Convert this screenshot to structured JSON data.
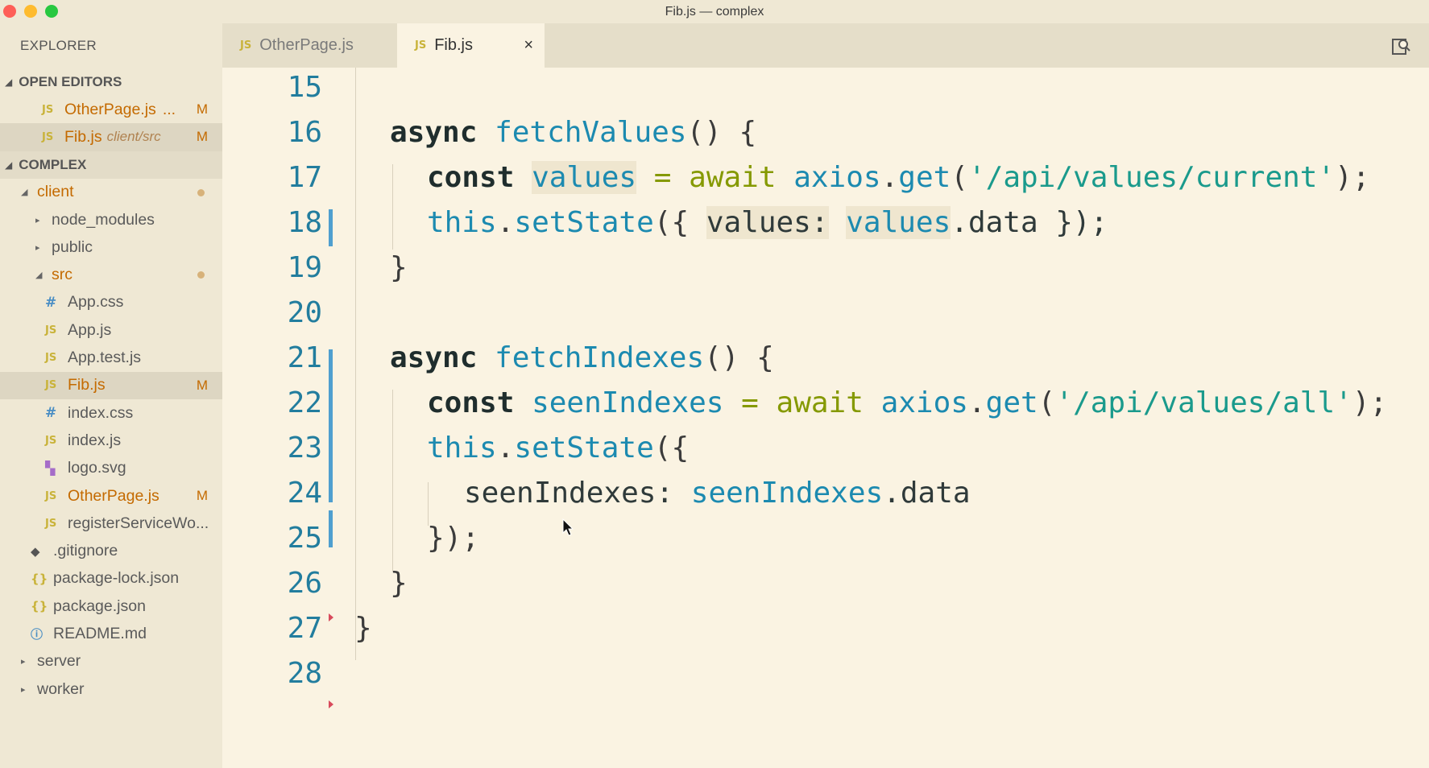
{
  "window": {
    "title": "Fib.js — complex"
  },
  "sidebar": {
    "header": "EXPLORER",
    "open_editors_label": "OPEN EDITORS",
    "open_editors": [
      {
        "name": "OtherPage.js",
        "extra": "...",
        "badge": "M"
      },
      {
        "name": "Fib.js",
        "extra": "client/src",
        "badge": "M"
      }
    ],
    "project_label": "COMPLEX",
    "tree": {
      "client": "client",
      "node_modules": "node_modules",
      "public": "public",
      "src": "src",
      "app_css": "App.css",
      "app_js": "App.js",
      "app_test_js": "App.test.js",
      "fib_js": "Fib.js",
      "fib_badge": "M",
      "index_css": "index.css",
      "index_js": "index.js",
      "logo_svg": "logo.svg",
      "otherpage_js": "OtherPage.js",
      "otherpage_badge": "M",
      "register_sw": "registerServiceWo...",
      "gitignore": ".gitignore",
      "package_lock": "package-lock.json",
      "package_json": "package.json",
      "readme": "README.md",
      "server": "server",
      "worker": "worker"
    },
    "icons": {
      "js": "JS",
      "css": "#",
      "json": "{}",
      "info": "ⓘ",
      "git": "◆",
      "svg": "▚"
    }
  },
  "tabs": [
    {
      "label": "OtherPage.js",
      "icon": "JS"
    },
    {
      "label": "Fib.js",
      "icon": "JS",
      "close": "×"
    }
  ],
  "editor": {
    "line_numbers": [
      "15",
      "16",
      "17",
      "18",
      "19",
      "20",
      "21",
      "22",
      "23",
      "24",
      "25",
      "26",
      "27",
      "28"
    ],
    "lines": {
      "l16": {
        "kw": "async",
        "fn": "fetchValues",
        "rest": "() {"
      },
      "l17": {
        "kw": "const",
        "var": "values",
        "eq": " = ",
        "await": "await",
        "obj": "axios",
        "dot": ".",
        "method": "get",
        "open": "(",
        "str": "'/api/values/current'",
        "close": ");"
      },
      "l18": {
        "this": "this",
        "dot": ".",
        "method": "setState",
        "open": "({ ",
        "key": "values:",
        "sp": " ",
        "ref": "values",
        "tail": ".data });"
      },
      "l19": {
        "brace": "}"
      },
      "l21": {
        "kw": "async",
        "fn": "fetchIndexes",
        "rest": "() {"
      },
      "l22": {
        "kw": "const",
        "var": "seenIndexes",
        "eq": " = ",
        "await": "await",
        "obj": "axios",
        "dot": ".",
        "method": "get",
        "open": "(",
        "str": "'/api/values/all'",
        "close": ");"
      },
      "l23": {
        "this": "this",
        "dot": ".",
        "method": "setState",
        "open": "({"
      },
      "l24": {
        "key": "seenIndexes:",
        "sp": " ",
        "ref": "seenIndexes",
        "tail": ".data"
      },
      "l25": {
        "text": "});"
      },
      "l26": {
        "brace": "}"
      },
      "l27": {
        "brace": "}"
      }
    }
  }
}
